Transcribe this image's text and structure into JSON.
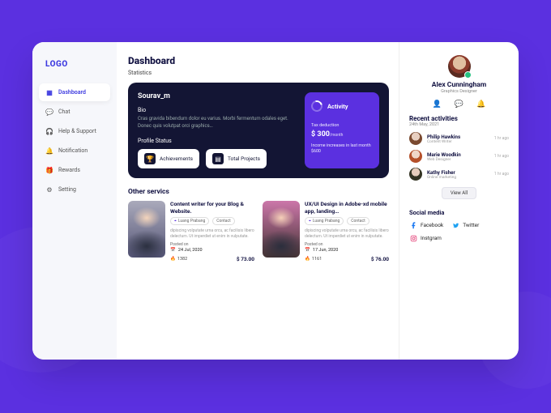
{
  "brand": {
    "logo": "LOGO"
  },
  "sidebar": {
    "items": [
      {
        "label": "Dashboard"
      },
      {
        "label": "Chat"
      },
      {
        "label": "Help & Support"
      },
      {
        "label": "Notification"
      },
      {
        "label": "Rewards"
      },
      {
        "label": "Setting"
      }
    ]
  },
  "page": {
    "title": "Dashboard",
    "subtitle": "Statistics",
    "other_services_heading": "Other servics"
  },
  "profile": {
    "name": "Sourav_m",
    "bio_label": "Bio",
    "bio_text": "Cras gravida bibendum dolor eu varius. Morbi fermentum odales eget. Donec quis volutpat orci graphics…",
    "status_label": "Profile Status",
    "buttons": {
      "achievements": "Achievements",
      "total_projects": "Total Projects"
    }
  },
  "activity": {
    "title": "Activity",
    "tax_label": "Tax deduction",
    "amount": "$ 300",
    "per": "/month",
    "note": "Income increases in last month $600"
  },
  "services": [
    {
      "title": "Content writer for your Blog & Website.",
      "location": "Luang Prabang",
      "contact": "Contact",
      "desc": "dipiscing volputate urna orcu, ac facilisis libero delectum. Ut imperdiet ut enim in vulputate.",
      "posted_label": "Posted on",
      "posted_on": "24 Jul, 2020",
      "views": "1382",
      "price": "$ 73.00"
    },
    {
      "title": "UX/UI Design in Adobe-xd mobile app, landing…",
      "location": "Luang Prabang",
      "contact": "Contact",
      "desc": "dipiscing volputate urna orcu, ac facilisis libero delectum. Ut imperdiet ut enim in vulputate.",
      "posted_label": "Posted on",
      "posted_on": "17 Jun, 2020",
      "views": "1161",
      "price": "$ 76.00"
    }
  ],
  "user": {
    "name": "Alex Cunningham",
    "role": "Graphics Designer"
  },
  "recent": {
    "heading": "Recent activities",
    "date": "24th May, 2021",
    "items": [
      {
        "name": "Philip Hawkins",
        "role": "Content Writer",
        "time": "1 hr ago"
      },
      {
        "name": "Marie Woodkin",
        "role": "Web Designer",
        "time": "1 hr ago"
      },
      {
        "name": "Kathy Fisher",
        "role": "Online marketing",
        "time": "1 hr ago"
      }
    ],
    "view_all": "View All"
  },
  "social": {
    "heading": "Social media",
    "facebook": "Facebook",
    "twitter": "Twitter",
    "instagram": "Instgram"
  }
}
